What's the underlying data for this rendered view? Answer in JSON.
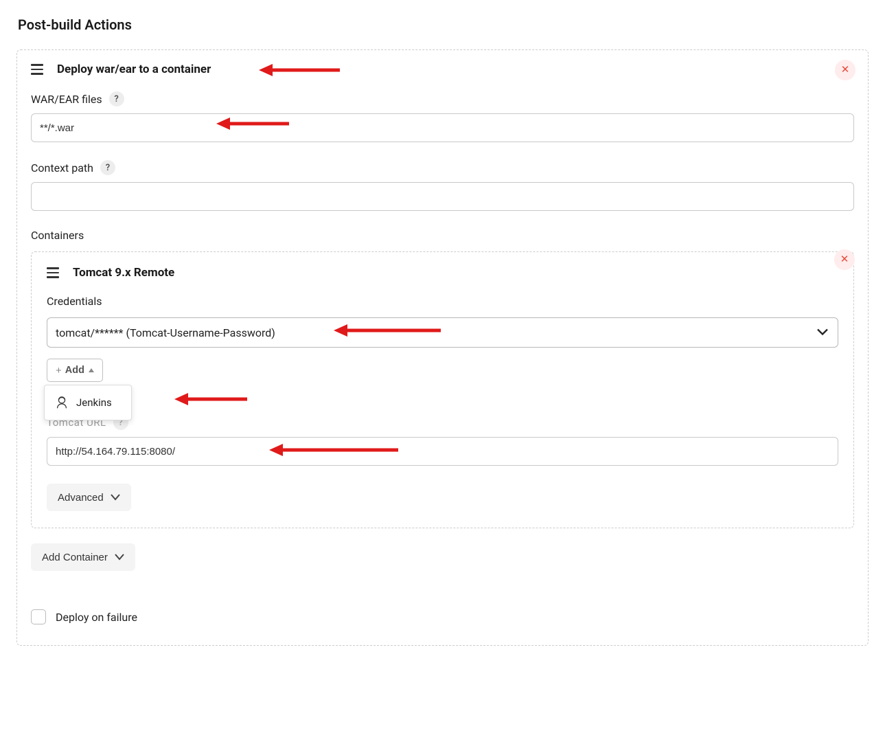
{
  "page": {
    "heading": "Post-build Actions"
  },
  "postbuild": {
    "title": "Deploy war/ear to a container",
    "war_files_label": "WAR/EAR files",
    "war_files_value": "**/*.war",
    "context_path_label": "Context path",
    "context_path_value": "",
    "containers_label": "Containers"
  },
  "container": {
    "title": "Tomcat 9.x Remote",
    "credentials_label": "Credentials",
    "credentials_value": "tomcat/****** (Tomcat-Username-Password)",
    "add_button_label": "Add",
    "dropdown_item": "Jenkins",
    "tomcat_url_ghost": "Tomcat URL",
    "tomcat_url_value": "http://54.164.79.115:8080/",
    "advanced_label": "Advanced"
  },
  "footer": {
    "add_container_label": "Add Container",
    "deploy_on_failure_label": "Deploy on failure"
  }
}
